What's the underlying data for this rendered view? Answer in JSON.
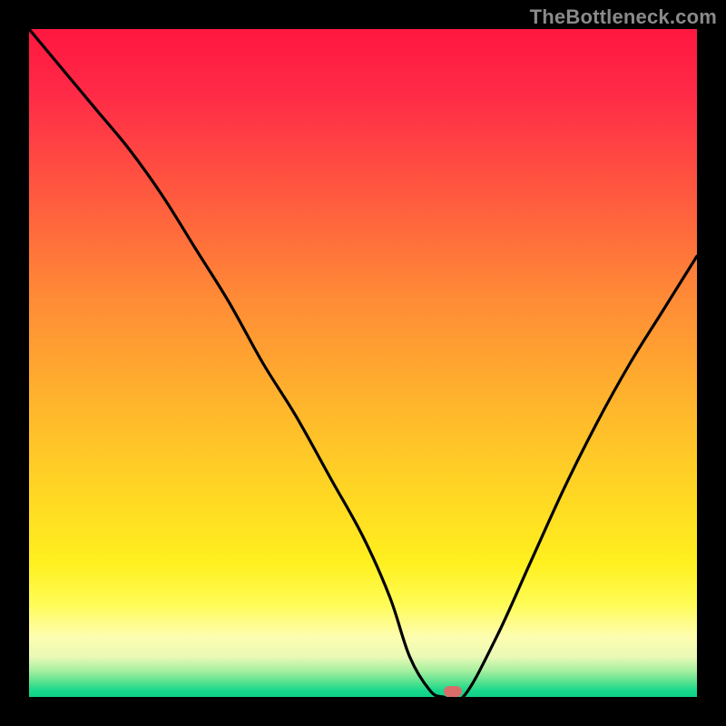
{
  "watermark": "TheBottleneck.com",
  "chart_data": {
    "type": "line",
    "title": "",
    "xlabel": "",
    "ylabel": "",
    "xlim": [
      0,
      100
    ],
    "ylim": [
      0,
      100
    ],
    "grid": false,
    "series": [
      {
        "name": "bottleneck-curve",
        "x": [
          0,
          5,
          10,
          15,
          20,
          25,
          30,
          35,
          40,
          45,
          50,
          54,
          57,
          60,
          62,
          65,
          70,
          75,
          80,
          85,
          90,
          95,
          100
        ],
        "y": [
          100,
          94,
          88,
          82,
          75,
          67,
          59,
          50,
          42,
          33,
          24,
          15,
          6,
          1,
          0,
          0,
          9,
          20,
          31,
          41,
          50,
          58,
          66
        ]
      }
    ],
    "optimum_marker": {
      "x": 63.5,
      "y": 0.8
    },
    "gradient_stops": [
      {
        "pos": 0.0,
        "color": "#ff1740"
      },
      {
        "pos": 0.4,
        "color": "#ff8a36"
      },
      {
        "pos": 0.7,
        "color": "#ffd823"
      },
      {
        "pos": 0.9,
        "color": "#fffc55"
      },
      {
        "pos": 1.0,
        "color": "#0fd186"
      }
    ]
  }
}
